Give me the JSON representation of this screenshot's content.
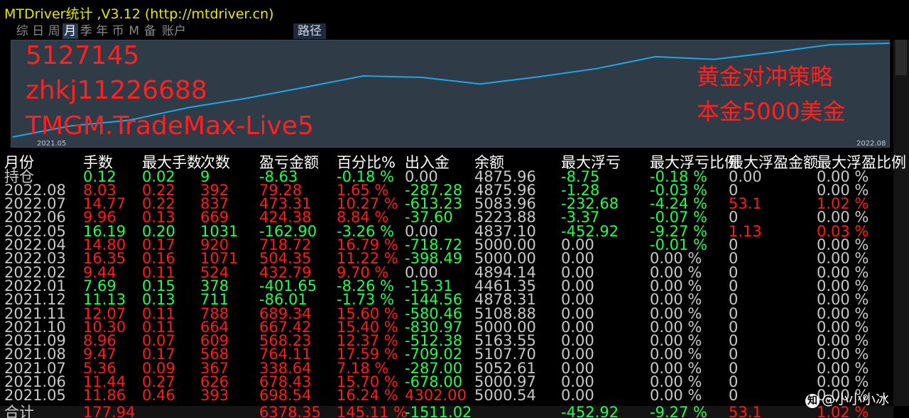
{
  "window": {
    "title": "MTDriver统计 ,V3.12 (http://mtdriver.cn)"
  },
  "tabs": [
    "综",
    "日",
    "周",
    "月",
    "季",
    "年",
    "币",
    "M",
    "备",
    "账户"
  ],
  "active_tab": "月",
  "path_button": "路径",
  "chart": {
    "overlay_left": [
      "5127145",
      "zhkj11226688",
      "TMGM.TradeMax-Live5"
    ],
    "overlay_right": [
      "黄金对冲策略",
      "本金5000美金"
    ],
    "x_start": "2021.05",
    "x_end": "2022.08",
    "line_color": "#1ea7e8",
    "bg_color": "#2f3b47"
  },
  "chart_data": {
    "type": "line",
    "x": [
      "2021.05",
      "2021.06",
      "2021.07",
      "2021.08",
      "2021.09",
      "2021.10",
      "2021.11",
      "2021.12",
      "2022.01",
      "2022.02",
      "2022.03",
      "2022.04",
      "2022.05",
      "2022.06",
      "2022.07",
      "2022.08"
    ],
    "values": [
      0,
      678.43,
      1017.07,
      1781.18,
      2349.41,
      3016.83,
      3706.17,
      3620.16,
      3218.51,
      3651.3,
      4155.65,
      4874.37,
      4711.47,
      5135.85,
      5609.16,
      5688.44
    ],
    "xlabel": "",
    "ylabel": "",
    "x_tick_labels": [
      "2021.05",
      "2022.08"
    ]
  },
  "table": {
    "headers": [
      "月份",
      "手数",
      "最大手数",
      "次数",
      "盈亏金额",
      "百分比%",
      "出入金",
      "余额",
      "最大浮亏",
      "最大浮亏比例",
      "最大浮盈金额",
      "最大浮盈比例"
    ],
    "rows": [
      {
        "cells": [
          "持仓",
          "0.12",
          "0.02",
          "9",
          "-8.63",
          "-0.18 %",
          "0.00",
          "4875.96",
          "-8.75",
          "-0.18 %",
          "0.00",
          "0.00 %"
        ],
        "colors": [
          "w",
          "g",
          "g",
          "g",
          "g",
          "g",
          "w",
          "w",
          "g",
          "g",
          "w",
          "w"
        ]
      },
      {
        "cells": [
          "2022.08",
          "8.03",
          "0.22",
          "392",
          "79.28",
          "1.65 %",
          "-287.28",
          "4875.96",
          "-1.28",
          "-0.03 %",
          "0",
          "0.00 %"
        ],
        "colors": [
          "w",
          "r",
          "r",
          "r",
          "r",
          "r",
          "g",
          "w",
          "g",
          "g",
          "w",
          "w"
        ]
      },
      {
        "cells": [
          "2022.07",
          "14.77",
          "0.22",
          "837",
          "473.31",
          "10.27 %",
          "-613.23",
          "5083.96",
          "-232.68",
          "-4.24 %",
          "53.1",
          "1.02 %"
        ],
        "colors": [
          "w",
          "r",
          "r",
          "r",
          "r",
          "r",
          "g",
          "w",
          "g",
          "g",
          "r",
          "r"
        ]
      },
      {
        "cells": [
          "2022.06",
          "9.96",
          "0.13",
          "669",
          "424.38",
          "8.84 %",
          "-37.60",
          "5223.88",
          "-3.37",
          "-0.07 %",
          "0",
          "0.00 %"
        ],
        "colors": [
          "w",
          "r",
          "r",
          "r",
          "r",
          "r",
          "g",
          "w",
          "g",
          "g",
          "w",
          "w"
        ]
      },
      {
        "cells": [
          "2022.05",
          "16.19",
          "0.20",
          "1031",
          "-162.90",
          "-3.26 %",
          "0.00",
          "4837.10",
          "-452.92",
          "-9.27 %",
          "1.13",
          "0.03 %"
        ],
        "colors": [
          "w",
          "g",
          "g",
          "g",
          "g",
          "g",
          "w",
          "w",
          "g",
          "g",
          "r",
          "r"
        ]
      },
      {
        "cells": [
          "2022.04",
          "14.80",
          "0.17",
          "920",
          "718.72",
          "16.79 %",
          "-718.72",
          "5000.00",
          "0.00",
          "-0.01 %",
          "0",
          "0.00 %"
        ],
        "colors": [
          "w",
          "r",
          "r",
          "r",
          "r",
          "r",
          "g",
          "w",
          "w",
          "g",
          "w",
          "w"
        ]
      },
      {
        "cells": [
          "2022.03",
          "16.35",
          "0.16",
          "1071",
          "504.35",
          "11.22 %",
          "-398.49",
          "5000.00",
          "0.00",
          "0.00 %",
          "0",
          "0.00 %"
        ],
        "colors": [
          "w",
          "r",
          "r",
          "r",
          "r",
          "r",
          "g",
          "w",
          "w",
          "w",
          "w",
          "w"
        ]
      },
      {
        "cells": [
          "2022.02",
          "9.44",
          "0.11",
          "524",
          "432.79",
          "9.70 %",
          "0.00",
          "4894.14",
          "0.00",
          "0.00 %",
          "0",
          "0.00 %"
        ],
        "colors": [
          "w",
          "r",
          "r",
          "r",
          "r",
          "r",
          "w",
          "w",
          "w",
          "w",
          "w",
          "w"
        ]
      },
      {
        "cells": [
          "2022.01",
          "7.69",
          "0.15",
          "378",
          "-401.65",
          "-8.26 %",
          "-15.31",
          "4461.35",
          "0.00",
          "0.00 %",
          "0",
          "0.00 %"
        ],
        "colors": [
          "w",
          "g",
          "g",
          "g",
          "g",
          "g",
          "g",
          "w",
          "w",
          "w",
          "w",
          "w"
        ]
      },
      {
        "cells": [
          "2021.12",
          "11.13",
          "0.13",
          "711",
          "-86.01",
          "-1.73 %",
          "-144.56",
          "4878.31",
          "0.00",
          "0.00 %",
          "0",
          "0.00 %"
        ],
        "colors": [
          "w",
          "g",
          "g",
          "g",
          "g",
          "g",
          "g",
          "w",
          "w",
          "w",
          "w",
          "w"
        ]
      },
      {
        "cells": [
          "2021.11",
          "12.07",
          "0.11",
          "788",
          "689.34",
          "15.60 %",
          "-580.46",
          "5108.88",
          "0.00",
          "0.00 %",
          "0",
          "0.00 %"
        ],
        "colors": [
          "w",
          "r",
          "r",
          "r",
          "r",
          "r",
          "g",
          "w",
          "w",
          "w",
          "w",
          "w"
        ]
      },
      {
        "cells": [
          "2021.10",
          "10.30",
          "0.11",
          "664",
          "667.42",
          "15.40 %",
          "-830.97",
          "5000.00",
          "0.00",
          "0.00 %",
          "0",
          "0.00 %"
        ],
        "colors": [
          "w",
          "r",
          "r",
          "r",
          "r",
          "r",
          "g",
          "w",
          "w",
          "w",
          "w",
          "w"
        ]
      },
      {
        "cells": [
          "2021.09",
          "8.96",
          "0.07",
          "609",
          "568.23",
          "12.37 %",
          "-512.38",
          "5163.55",
          "0.00",
          "0.00 %",
          "0",
          "0.00 %"
        ],
        "colors": [
          "w",
          "r",
          "r",
          "r",
          "r",
          "r",
          "g",
          "w",
          "w",
          "w",
          "w",
          "w"
        ]
      },
      {
        "cells": [
          "2021.08",
          "9.47",
          "0.17",
          "568",
          "764.11",
          "17.59 %",
          "-709.02",
          "5107.70",
          "0.00",
          "0.00 %",
          "0",
          "0.00 %"
        ],
        "colors": [
          "w",
          "r",
          "r",
          "r",
          "r",
          "r",
          "g",
          "w",
          "w",
          "w",
          "w",
          "w"
        ]
      },
      {
        "cells": [
          "2021.07",
          "5.36",
          "0.09",
          "367",
          "338.64",
          "7.18 %",
          "-287.00",
          "5052.61",
          "0.00",
          "0.00 %",
          "0",
          "0.00 %"
        ],
        "colors": [
          "w",
          "r",
          "r",
          "r",
          "r",
          "r",
          "g",
          "w",
          "w",
          "w",
          "w",
          "w"
        ]
      },
      {
        "cells": [
          "2021.06",
          "11.44",
          "0.27",
          "626",
          "678.43",
          "15.70 %",
          "-678.00",
          "5000.97",
          "0.00",
          "0.00 %",
          "0",
          "0.00 %"
        ],
        "colors": [
          "w",
          "r",
          "r",
          "r",
          "r",
          "r",
          "g",
          "w",
          "w",
          "w",
          "w",
          "w"
        ]
      },
      {
        "cells": [
          "2021.05",
          "11.86",
          "0.46",
          "393",
          "698.54",
          "16.24 %",
          "4302.00",
          "5000.54",
          "0.00",
          "0.00 %",
          "0",
          "0.00 %"
        ],
        "colors": [
          "w",
          "r",
          "r",
          "r",
          "r",
          "r",
          "r",
          "w",
          "w",
          "w",
          "w",
          "w"
        ]
      }
    ],
    "total": {
      "cells": [
        "合计",
        "177.94",
        "",
        "",
        "6378.35",
        "145.11 %",
        "-1511.02",
        "",
        "-452.92",
        "-9.27 %",
        "53.1",
        "1.02 %"
      ],
      "colors": [
        "w",
        "r",
        "r",
        "r",
        "r",
        "r",
        "g",
        "w",
        "g",
        "g",
        "r",
        "r"
      ]
    }
  },
  "watermark": {
    "icon": "zhihu-logo-icon",
    "text": "@小小小冰"
  }
}
